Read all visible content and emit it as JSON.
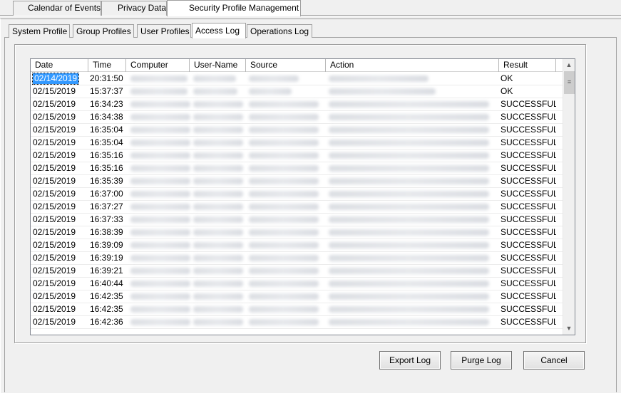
{
  "top_tabs": [
    {
      "label": "Calendar of Events"
    },
    {
      "label": "Privacy Data"
    },
    {
      "label": "Security Profile Management"
    }
  ],
  "sub_tabs": [
    {
      "label": "System Profile"
    },
    {
      "label": "Group Profiles"
    },
    {
      "label": "User Profiles"
    },
    {
      "label": "Access Log"
    },
    {
      "label": "Operations Log"
    }
  ],
  "table": {
    "columns": [
      "Date",
      "Time",
      "Computer",
      "User-Name",
      "Source",
      "Action",
      "Result"
    ],
    "rows": [
      {
        "date": "02/14/2019",
        "time": "20:31:50",
        "result": "OK"
      },
      {
        "date": "02/15/2019",
        "time": "15:37:37",
        "result": "OK"
      },
      {
        "date": "02/15/2019",
        "time": "16:34:23",
        "result": "SUCCESSFUL"
      },
      {
        "date": "02/15/2019",
        "time": "16:34:38",
        "result": "SUCCESSFUL"
      },
      {
        "date": "02/15/2019",
        "time": "16:35:04",
        "result": "SUCCESSFUL"
      },
      {
        "date": "02/15/2019",
        "time": "16:35:04",
        "result": "SUCCESSFUL"
      },
      {
        "date": "02/15/2019",
        "time": "16:35:16",
        "result": "SUCCESSFUL"
      },
      {
        "date": "02/15/2019",
        "time": "16:35:16",
        "result": "SUCCESSFUL"
      },
      {
        "date": "02/15/2019",
        "time": "16:35:39",
        "result": "SUCCESSFUL"
      },
      {
        "date": "02/15/2019",
        "time": "16:37:00",
        "result": "SUCCESSFUL"
      },
      {
        "date": "02/15/2019",
        "time": "16:37:27",
        "result": "SUCCESSFUL"
      },
      {
        "date": "02/15/2019",
        "time": "16:37:33",
        "result": "SUCCESSFUL"
      },
      {
        "date": "02/15/2019",
        "time": "16:38:39",
        "result": "SUCCESSFUL"
      },
      {
        "date": "02/15/2019",
        "time": "16:39:09",
        "result": "SUCCESSFUL"
      },
      {
        "date": "02/15/2019",
        "time": "16:39:19",
        "result": "SUCCESSFUL"
      },
      {
        "date": "02/15/2019",
        "time": "16:39:21",
        "result": "SUCCESSFUL"
      },
      {
        "date": "02/15/2019",
        "time": "16:40:44",
        "result": "SUCCESSFUL"
      },
      {
        "date": "02/15/2019",
        "time": "16:42:35",
        "result": "SUCCESSFUL"
      },
      {
        "date": "02/15/2019",
        "time": "16:42:35",
        "result": "SUCCESSFUL"
      },
      {
        "date": "02/15/2019",
        "time": "16:42:36",
        "result": "SUCCESSFUL"
      }
    ]
  },
  "buttons": {
    "export": "Export Log",
    "purge": "Purge Log",
    "cancel": "Cancel"
  },
  "icons": {
    "scroll_up": "chevron-up-icon",
    "scroll_down": "chevron-down-icon",
    "thumb": "grip-icon"
  },
  "colors": {
    "selection": "#3399ff",
    "background": "#f0f0f0"
  }
}
